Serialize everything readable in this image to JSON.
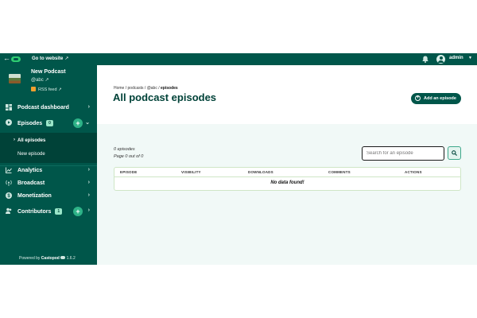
{
  "topbar": {
    "goto_label": "Go to website",
    "admin_label": "admin"
  },
  "podcast": {
    "title": "New Podcast",
    "handle": "@abc",
    "rss_label": "RSS feed"
  },
  "nav": {
    "dashboard": "Podcast dashboard",
    "episodes": "Episodes",
    "episodes_count": "0",
    "all_episodes": "All episodes",
    "new_episode": "New episode",
    "analytics": "Analytics",
    "broadcast": "Broadcast",
    "monetization": "Monetization",
    "contributors": "Contributors",
    "contributors_count": "1"
  },
  "footer": {
    "powered_prefix": "Powered by",
    "brand": "Castopod",
    "version": "1.6.2"
  },
  "main": {
    "breadcrumb": [
      "Home",
      "podcasts",
      "@abc",
      "episodes"
    ],
    "title": "All podcast episodes",
    "add_button": "Add an episode",
    "episode_count": "0 episodes",
    "page_info": "Page 0 out of 0",
    "search_placeholder": "Search for an episode",
    "columns": [
      "EPISODE",
      "VISIBILITY",
      "DOWNLOADS",
      "COMMENTS",
      "ACTIONS"
    ],
    "empty_message": "No data found!"
  },
  "colors": {
    "brand": "#00564a",
    "accent": "#2db287"
  }
}
